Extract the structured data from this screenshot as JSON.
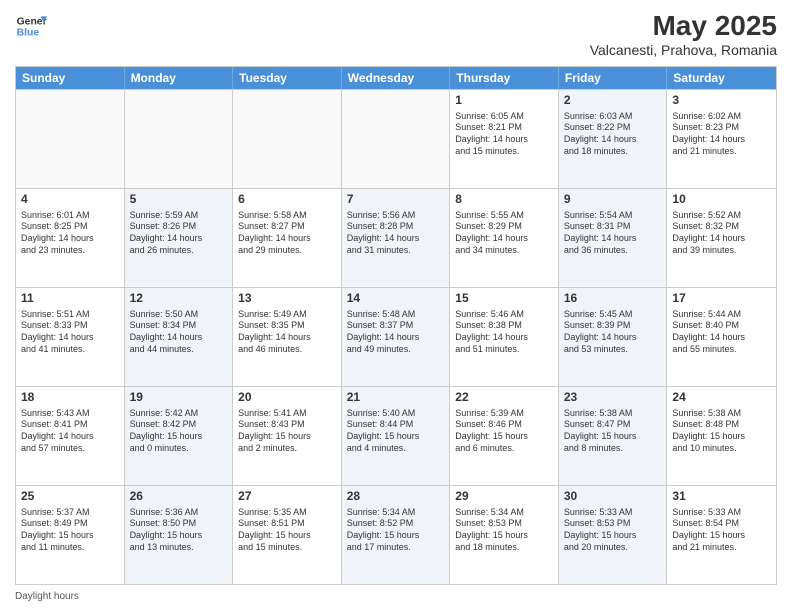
{
  "header": {
    "logo_line1": "General",
    "logo_line2": "Blue",
    "title": "May 2025",
    "subtitle": "Valcanesti, Prahova, Romania"
  },
  "calendar": {
    "days_of_week": [
      "Sunday",
      "Monday",
      "Tuesday",
      "Wednesday",
      "Thursday",
      "Friday",
      "Saturday"
    ],
    "weeks": [
      [
        {
          "day": "",
          "info": "",
          "empty": true
        },
        {
          "day": "",
          "info": "",
          "empty": true
        },
        {
          "day": "",
          "info": "",
          "empty": true
        },
        {
          "day": "",
          "info": "",
          "empty": true
        },
        {
          "day": "1",
          "info": "Sunrise: 6:05 AM\nSunset: 8:21 PM\nDaylight: 14 hours\nand 15 minutes.",
          "shaded": false
        },
        {
          "day": "2",
          "info": "Sunrise: 6:03 AM\nSunset: 8:22 PM\nDaylight: 14 hours\nand 18 minutes.",
          "shaded": true
        },
        {
          "day": "3",
          "info": "Sunrise: 6:02 AM\nSunset: 8:23 PM\nDaylight: 14 hours\nand 21 minutes.",
          "shaded": false
        }
      ],
      [
        {
          "day": "4",
          "info": "Sunrise: 6:01 AM\nSunset: 8:25 PM\nDaylight: 14 hours\nand 23 minutes.",
          "shaded": false
        },
        {
          "day": "5",
          "info": "Sunrise: 5:59 AM\nSunset: 8:26 PM\nDaylight: 14 hours\nand 26 minutes.",
          "shaded": true
        },
        {
          "day": "6",
          "info": "Sunrise: 5:58 AM\nSunset: 8:27 PM\nDaylight: 14 hours\nand 29 minutes.",
          "shaded": false
        },
        {
          "day": "7",
          "info": "Sunrise: 5:56 AM\nSunset: 8:28 PM\nDaylight: 14 hours\nand 31 minutes.",
          "shaded": true
        },
        {
          "day": "8",
          "info": "Sunrise: 5:55 AM\nSunset: 8:29 PM\nDaylight: 14 hours\nand 34 minutes.",
          "shaded": false
        },
        {
          "day": "9",
          "info": "Sunrise: 5:54 AM\nSunset: 8:31 PM\nDaylight: 14 hours\nand 36 minutes.",
          "shaded": true
        },
        {
          "day": "10",
          "info": "Sunrise: 5:52 AM\nSunset: 8:32 PM\nDaylight: 14 hours\nand 39 minutes.",
          "shaded": false
        }
      ],
      [
        {
          "day": "11",
          "info": "Sunrise: 5:51 AM\nSunset: 8:33 PM\nDaylight: 14 hours\nand 41 minutes.",
          "shaded": false
        },
        {
          "day": "12",
          "info": "Sunrise: 5:50 AM\nSunset: 8:34 PM\nDaylight: 14 hours\nand 44 minutes.",
          "shaded": true
        },
        {
          "day": "13",
          "info": "Sunrise: 5:49 AM\nSunset: 8:35 PM\nDaylight: 14 hours\nand 46 minutes.",
          "shaded": false
        },
        {
          "day": "14",
          "info": "Sunrise: 5:48 AM\nSunset: 8:37 PM\nDaylight: 14 hours\nand 49 minutes.",
          "shaded": true
        },
        {
          "day": "15",
          "info": "Sunrise: 5:46 AM\nSunset: 8:38 PM\nDaylight: 14 hours\nand 51 minutes.",
          "shaded": false
        },
        {
          "day": "16",
          "info": "Sunrise: 5:45 AM\nSunset: 8:39 PM\nDaylight: 14 hours\nand 53 minutes.",
          "shaded": true
        },
        {
          "day": "17",
          "info": "Sunrise: 5:44 AM\nSunset: 8:40 PM\nDaylight: 14 hours\nand 55 minutes.",
          "shaded": false
        }
      ],
      [
        {
          "day": "18",
          "info": "Sunrise: 5:43 AM\nSunset: 8:41 PM\nDaylight: 14 hours\nand 57 minutes.",
          "shaded": false
        },
        {
          "day": "19",
          "info": "Sunrise: 5:42 AM\nSunset: 8:42 PM\nDaylight: 15 hours\nand 0 minutes.",
          "shaded": true
        },
        {
          "day": "20",
          "info": "Sunrise: 5:41 AM\nSunset: 8:43 PM\nDaylight: 15 hours\nand 2 minutes.",
          "shaded": false
        },
        {
          "day": "21",
          "info": "Sunrise: 5:40 AM\nSunset: 8:44 PM\nDaylight: 15 hours\nand 4 minutes.",
          "shaded": true
        },
        {
          "day": "22",
          "info": "Sunrise: 5:39 AM\nSunset: 8:46 PM\nDaylight: 15 hours\nand 6 minutes.",
          "shaded": false
        },
        {
          "day": "23",
          "info": "Sunrise: 5:38 AM\nSunset: 8:47 PM\nDaylight: 15 hours\nand 8 minutes.",
          "shaded": true
        },
        {
          "day": "24",
          "info": "Sunrise: 5:38 AM\nSunset: 8:48 PM\nDaylight: 15 hours\nand 10 minutes.",
          "shaded": false
        }
      ],
      [
        {
          "day": "25",
          "info": "Sunrise: 5:37 AM\nSunset: 8:49 PM\nDaylight: 15 hours\nand 11 minutes.",
          "shaded": false
        },
        {
          "day": "26",
          "info": "Sunrise: 5:36 AM\nSunset: 8:50 PM\nDaylight: 15 hours\nand 13 minutes.",
          "shaded": true
        },
        {
          "day": "27",
          "info": "Sunrise: 5:35 AM\nSunset: 8:51 PM\nDaylight: 15 hours\nand 15 minutes.",
          "shaded": false
        },
        {
          "day": "28",
          "info": "Sunrise: 5:34 AM\nSunset: 8:52 PM\nDaylight: 15 hours\nand 17 minutes.",
          "shaded": true
        },
        {
          "day": "29",
          "info": "Sunrise: 5:34 AM\nSunset: 8:53 PM\nDaylight: 15 hours\nand 18 minutes.",
          "shaded": false
        },
        {
          "day": "30",
          "info": "Sunrise: 5:33 AM\nSunset: 8:53 PM\nDaylight: 15 hours\nand 20 minutes.",
          "shaded": true
        },
        {
          "day": "31",
          "info": "Sunrise: 5:33 AM\nSunset: 8:54 PM\nDaylight: 15 hours\nand 21 minutes.",
          "shaded": false
        }
      ]
    ]
  },
  "footer": {
    "text": "Daylight hours"
  }
}
